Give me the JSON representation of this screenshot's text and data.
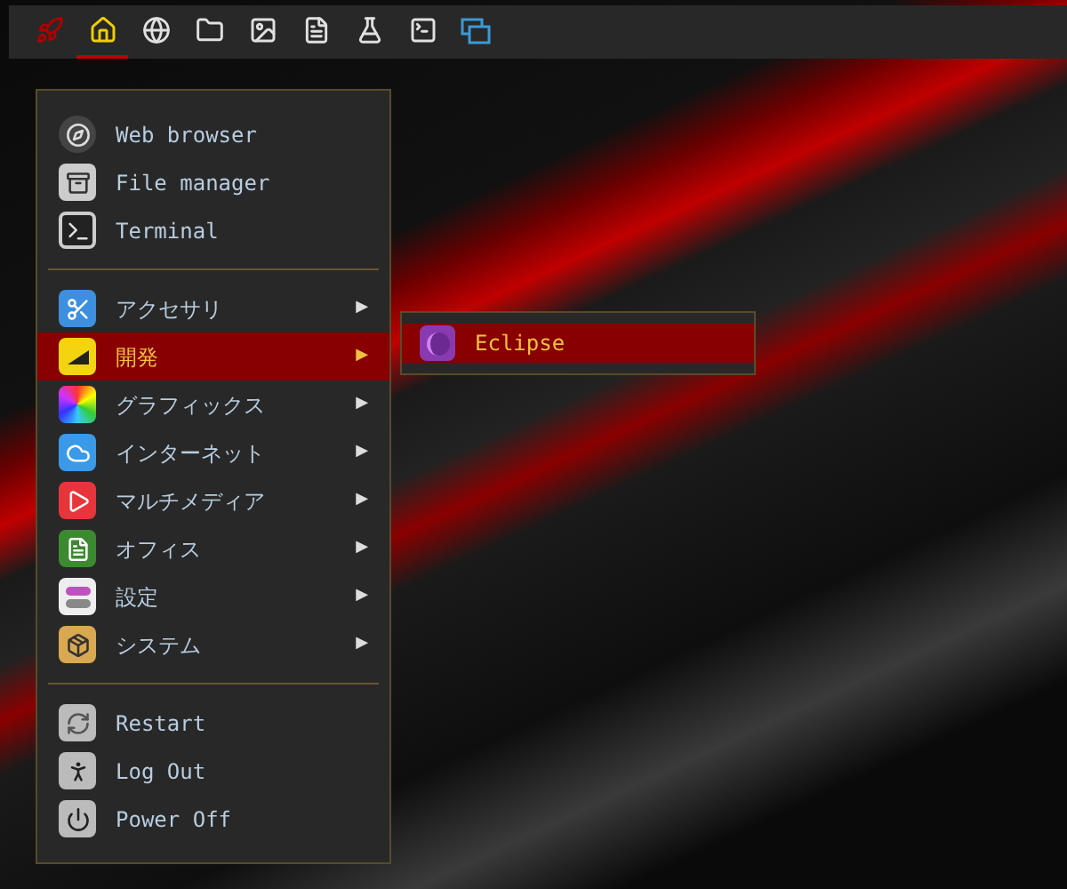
{
  "taskbar": {
    "items": [
      {
        "kind": "launcher",
        "selected": false
      },
      {
        "kind": "home",
        "selected": true
      },
      {
        "kind": "globe",
        "selected": false
      },
      {
        "kind": "folder",
        "selected": false
      },
      {
        "kind": "image",
        "selected": false
      },
      {
        "kind": "document",
        "selected": false
      },
      {
        "kind": "flask",
        "selected": false
      },
      {
        "kind": "terminal",
        "selected": false
      },
      {
        "kind": "windows",
        "selected": false
      }
    ]
  },
  "menu": {
    "apps": [
      {
        "label": "Web browser",
        "kind": "browser"
      },
      {
        "label": "File manager",
        "kind": "files"
      },
      {
        "label": "Terminal",
        "kind": "terminal"
      }
    ],
    "categories": [
      {
        "label": "アクセサリ",
        "kind": "scissors",
        "arrow": "▶",
        "selected": false
      },
      {
        "label": "開発",
        "kind": "dev",
        "arrow": "▶",
        "selected": true
      },
      {
        "label": "グラフィックス",
        "kind": "graphics",
        "arrow": "▶",
        "selected": false
      },
      {
        "label": "インターネット",
        "kind": "cloud",
        "arrow": "▶",
        "selected": false
      },
      {
        "label": "マルチメディア",
        "kind": "play",
        "arrow": "▶",
        "selected": false
      },
      {
        "label": "オフィス",
        "kind": "office",
        "arrow": "▶",
        "selected": false
      },
      {
        "label": "設定",
        "kind": "toggles",
        "arrow": "▶",
        "selected": false
      },
      {
        "label": "システム",
        "kind": "box",
        "arrow": "▶",
        "selected": false
      }
    ],
    "actions": [
      {
        "label": "Restart",
        "kind": "restart"
      },
      {
        "label": "Log Out",
        "kind": "logout"
      },
      {
        "label": "Power Off",
        "kind": "power"
      }
    ]
  },
  "submenu": {
    "items": [
      {
        "label": "Eclipse",
        "selected": true
      }
    ]
  }
}
